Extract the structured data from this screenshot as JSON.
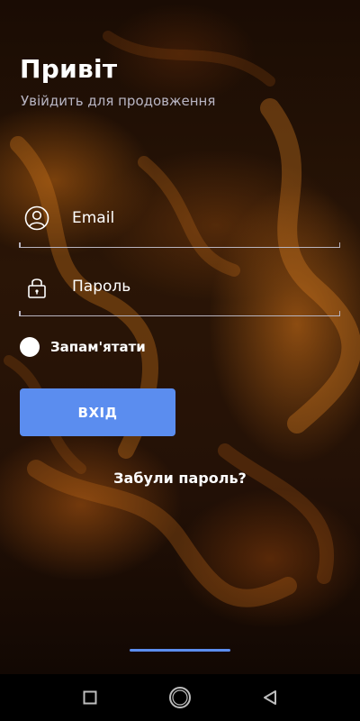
{
  "header": {
    "title": "Привіт",
    "subtitle": "Увійдить для продовження"
  },
  "form": {
    "email_placeholder": "Email",
    "password_placeholder": "Пароль",
    "email_icon": "user-circle-icon",
    "password_icon": "lock-icon",
    "remember_label": "Запам'ятати",
    "remember_checked": false,
    "login_label": "ВХІД",
    "forgot_label": "Забули пароль?"
  },
  "navbar": {
    "icons": [
      "recent-apps-icon",
      "home-icon",
      "back-icon"
    ]
  },
  "colors": {
    "accent": "#5b8def",
    "navbar_bg": "#000000",
    "text": "#ffffff",
    "subtitle": "#b9b6c4"
  }
}
